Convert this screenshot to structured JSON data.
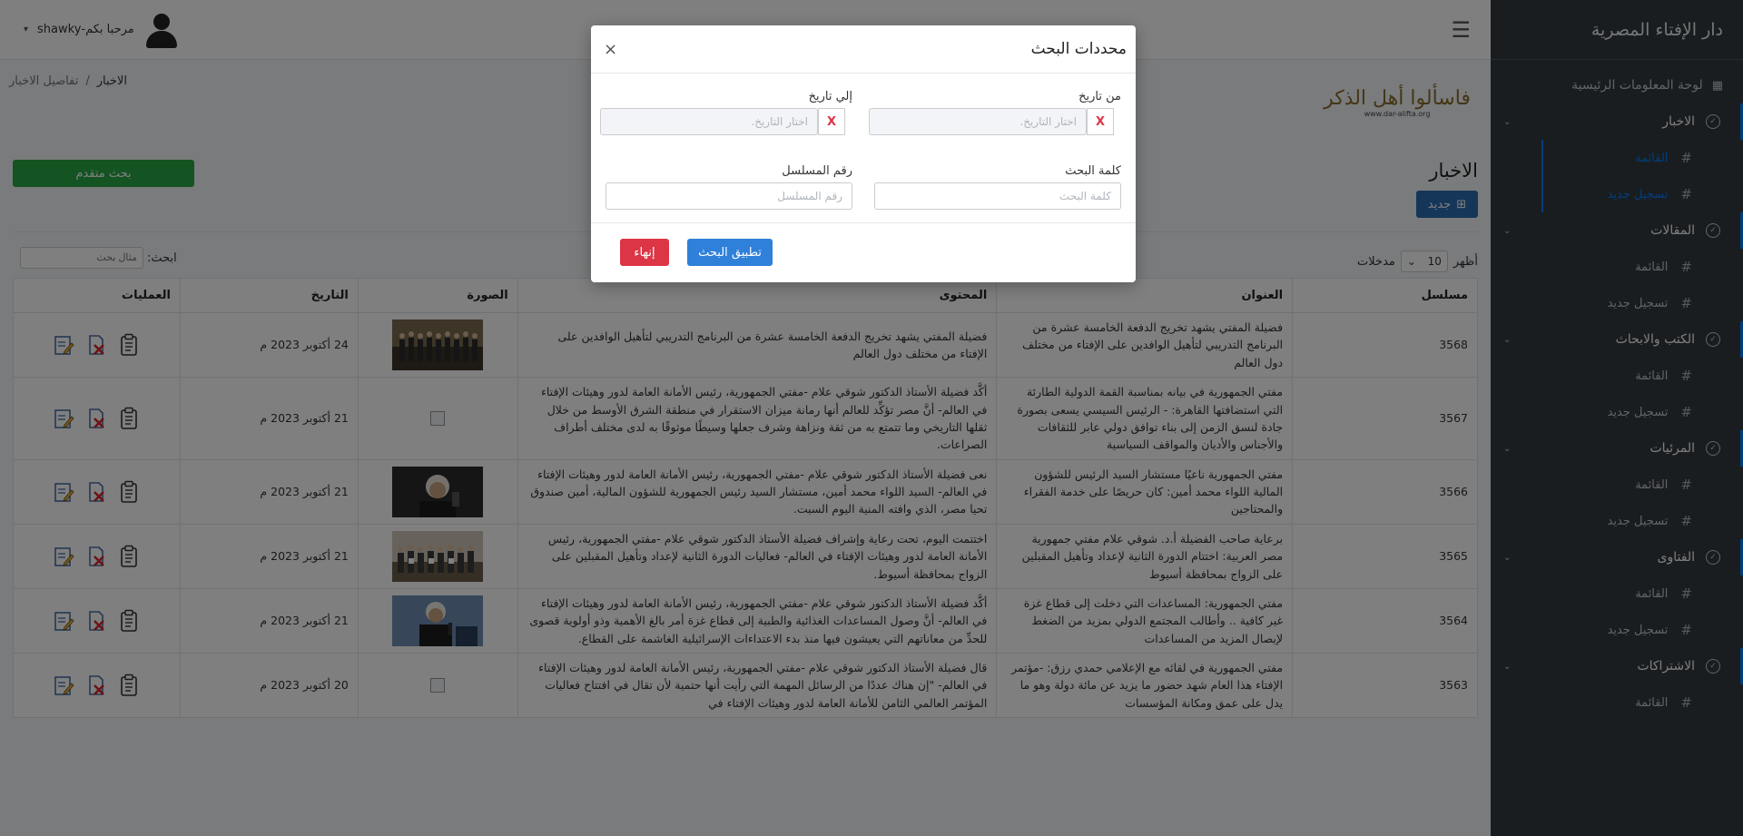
{
  "sidebar": {
    "brand": "دار الإفتاء المصرية",
    "dashboard": "لوحة المعلومات الرئيسية",
    "groups": [
      {
        "label": "الاخبار",
        "items": [
          "القائمة",
          "تسجيل جديد"
        ]
      },
      {
        "label": "المقالات",
        "items": [
          "القائمة",
          "تسجيل جديد"
        ]
      },
      {
        "label": "الكتب والابحاث",
        "items": [
          "القائمة",
          "تسجيل جديد"
        ]
      },
      {
        "label": "المرئيات",
        "items": [
          "القائمة",
          "تسجيل جديد"
        ]
      },
      {
        "label": "الفتاوى",
        "items": [
          "القائمة",
          "تسجيل جديد"
        ]
      },
      {
        "label": "الاشتراكات",
        "items": [
          "القائمة"
        ]
      }
    ]
  },
  "header": {
    "greeting": "مرحبا بكم-shawky",
    "logo_text": "فاسألوا أهل الذكر",
    "logo_url": "www.dar-alifta.org",
    "breadcrumb": [
      "الاخبار",
      "/",
      "تفاصيل الاخبار"
    ]
  },
  "page": {
    "title": "الاخبار",
    "new_label": "جديد",
    "advanced_search": "بحث متقدم",
    "show_label": "أظهر",
    "page_size": "10",
    "entries_label": "مدخلات",
    "search_label": "ابحث:",
    "search_placeholder": "مثال بحث"
  },
  "table": {
    "headers": [
      "مسلسل",
      "العنوان",
      "المحتوى",
      "الصورة",
      "التاريخ",
      "العمليات"
    ],
    "rows": [
      {
        "id": "3568",
        "title": "فضيلة المفتي يشهد تخريج الدفعة الخامسة عشرة من البرنامج التدريبي لتأهيل الوافدين على الإفتاء من مختلف دول العالم",
        "content": "فضيلة المفتي يشهد تخريج الدفعة الخامسة عشرة من البرنامج التدريبي لتأهيل الوافدين على الإفتاء من مختلف دول العالم",
        "image": "group",
        "date": "24 أكتوبر 2023 م"
      },
      {
        "id": "3567",
        "title": "مفتي الجمهورية في بيانه بمناسبة القمة الدولية الطارئة التي استضافتها القاهرة: - الرئيس السيسي يسعى بصورة جادة لنسق الزمن إلى بناء توافق دولي عابر للثقافات والأجناس والأديان والمواقف السياسية",
        "content": "أكَّد فضيلة الأستاذ الدكتور شوقي علام -مفتي الجمهورية، رئيس الأمانة العامة لدور وهيئات الإفتاء في العالم- أنَّ مصر تؤكِّد للعالم أنها رمانة ميزان الاستقرار في منطقة الشرق الأوسط من خلال ثقلها التاريخي وما تتمتع به من ثقة ونزاهة وشرف جعلها وسيطًا موثوقًا به لدى مختلف أطراف الصراعات.",
        "image": "broken",
        "date": "21 أكتوبر 2023 م"
      },
      {
        "id": "3566",
        "title": "مفتي الجمهورية ناعيًا مستشار السيد الرئيس للشؤون المالية اللواء محمد أمين: كان حريصًا على خدمة الفقراء والمحتاجين",
        "content": "نعى فضيلة الأستاذ الدكتور شوقي علام -مفتي الجمهورية، رئيس الأمانة العامة لدور وهيئات الإفتاء في العالم- السيد اللواء محمد أمين، مستشار السيد رئيس الجمهورية للشؤون المالية، أمين صندوق تحيا مصر، الذي وافته المنية اليوم السبت.",
        "image": "portrait",
        "date": "21 أكتوبر 2023 م"
      },
      {
        "id": "3565",
        "title": "برعاية صاحب الفضيلة أ.د. شوقي علام مفتي جمهورية مصر العربية: اختتام الدورة الثانية لإعداد وتأهيل المقبلين على الزواج بمحافظة أسيوط",
        "content": "اختتمت اليوم، تحت رعاية وإشراف فضيلة الأستاذ الدكتور شوقي علام -مفتي الجمهورية، رئيس الأمانة العامة لدور وهيئات الإفتاء في العالم- فعاليات الدورة الثانية لإعداد وتأهيل المقبلين على الزواج بمحافظة أسيوط.",
        "image": "group2",
        "date": "21 أكتوبر 2023 م"
      },
      {
        "id": "3564",
        "title": "مفتي الجمهورية: المساعدات التي دخلت إلى قطاع غزة غير كافية .. وأطالب المجتمع الدولي بمزيد من الضغط لإيصال المزيد من المساعدات",
        "content": "أكَّد فضيلة الأستاذ الدكتور شوقي علام -مفتي الجمهورية، رئيس الأمانة العامة لدور وهيئات الإفتاء في العالم- أنَّ وصول المساعدات الغذائية والطبية إلى قطاع غزة أمر بالغ الأهمية وذو أولوية قصوى للحدِّ من معاناتهم التي يعيشون فيها منذ بدء الاعتداءات الإسرائيلية الغاشمة على القطاع.",
        "image": "speaker",
        "date": "21 أكتوبر 2023 م"
      },
      {
        "id": "3563",
        "title": "مفتي الجمهورية في لقائه مع الإعلامي حمدي رزق: -مؤتمر الإفتاء هذا العام شهد حضور ما يزيد عن مائة دولة وهو ما يدل على عمق ومكانة المؤسسات",
        "content": "قال فضيلة الأستاذ الدكتور شوقي علام -مفتي الجمهورية، رئيس الأمانة العامة لدور وهيئات الإفتاء في العالم- \"إن هناك عددًا من الرسائل المهمة التي رأيت أنها حتمية لأن تقال في افتتاح فعاليات المؤتمر العالمي الثامن للأمانة العامة لدور وهيئات الإفتاء في",
        "image": "broken",
        "date": "20 أكتوبر 2023 م"
      }
    ]
  },
  "modal": {
    "title": "محددات البحث",
    "close": "×",
    "from_date_label": "من تاريخ",
    "to_date_label": "إلي تاريخ",
    "date_placeholder": "اختار التاريخ.",
    "clear": "X",
    "keyword_label": "كلمة البحث",
    "keyword_placeholder": "كلمة البحث",
    "serial_label": "رقم المسلسل",
    "serial_placeholder": "رقم المسلسل",
    "apply": "تطبيق البحث",
    "end": "إنهاء"
  }
}
